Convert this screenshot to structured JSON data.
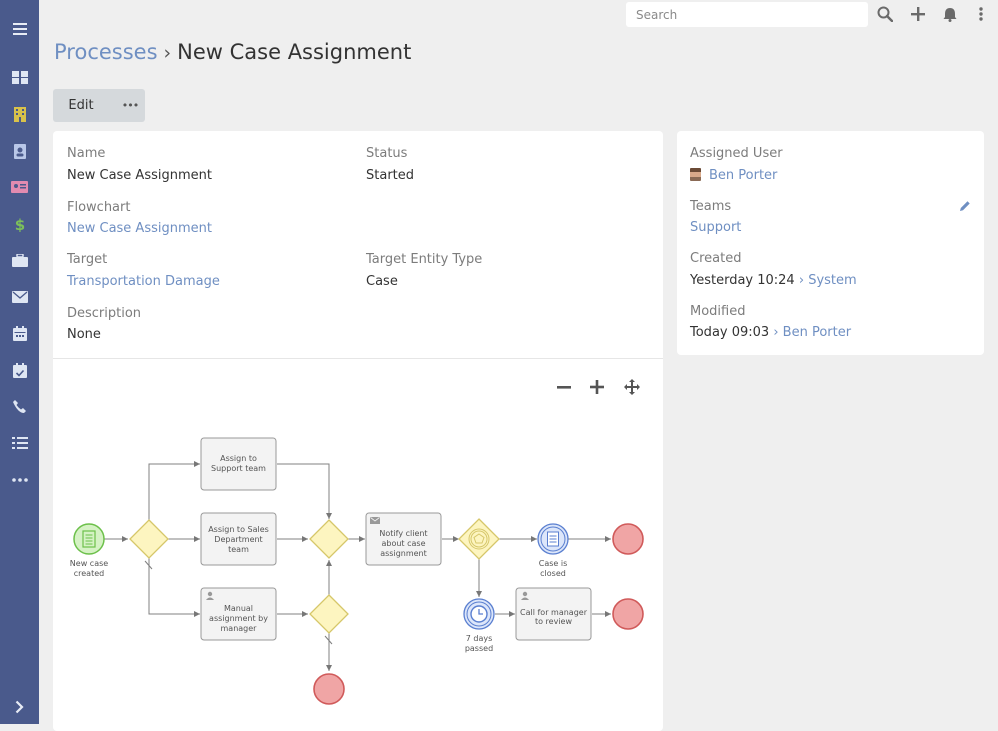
{
  "search": {
    "placeholder": "Search"
  },
  "breadcrumb": {
    "parent": "Processes",
    "separator": "›",
    "current": "New Case Assignment"
  },
  "buttons": {
    "edit": "Edit",
    "more": "•••"
  },
  "fields": {
    "name_label": "Name",
    "name_value": "New Case Assignment",
    "status_label": "Status",
    "status_value": "Started",
    "flowchart_label": "Flowchart",
    "flowchart_value": "New Case Assignment",
    "target_label": "Target",
    "target_value": "Transportation Damage",
    "target_entity_label": "Target Entity Type",
    "target_entity_value": "Case",
    "description_label": "Description",
    "description_value": "None"
  },
  "side": {
    "assigned_label": "Assigned User",
    "assigned_value": "Ben Porter",
    "teams_label": "Teams",
    "teams_value": "Support",
    "created_label": "Created",
    "created_value": "Yesterday 10:24",
    "created_by": "› System",
    "modified_label": "Modified",
    "modified_value": "Today 09:03",
    "modified_by": "› Ben Porter"
  },
  "flowchart": {
    "start_label": [
      "New case",
      "created"
    ],
    "task_support": [
      "Assign to",
      "Support team"
    ],
    "task_sales": [
      "Assign to Sales",
      "Department",
      "team"
    ],
    "task_manual": [
      "Manual",
      "assignment by",
      "manager"
    ],
    "task_notify": [
      "Notify client",
      "about case",
      "assignment"
    ],
    "event_closed": [
      "Case is",
      "closed"
    ],
    "event_timer": [
      "7 days",
      "passed"
    ],
    "task_call": [
      "Call for manager",
      "to review"
    ]
  },
  "colors": {
    "sidebar": "#4a5a8c",
    "link": "#6f8fc2",
    "gateway_fill": "#fdf5c0",
    "gateway_stroke": "#d6c76a",
    "end_fill": "#f0a5a5",
    "end_stroke": "#d05a5a",
    "start_fill": "#d5f2c4",
    "start_stroke": "#6cc04a",
    "event_blue": "#5a7fd0"
  },
  "icons": {
    "sidebar": [
      "menu-icon",
      "dashboard-icon",
      "building-icon",
      "contact-icon",
      "id-card-icon",
      "dollar-icon",
      "briefcase-icon",
      "envelope-icon",
      "calendar-icon",
      "calendar-check-icon",
      "phone-icon",
      "tasks-icon",
      "more-icon",
      "chevron-right-icon"
    ],
    "topbar": [
      "search-icon",
      "plus-icon",
      "bell-icon",
      "kebab-icon"
    ]
  }
}
